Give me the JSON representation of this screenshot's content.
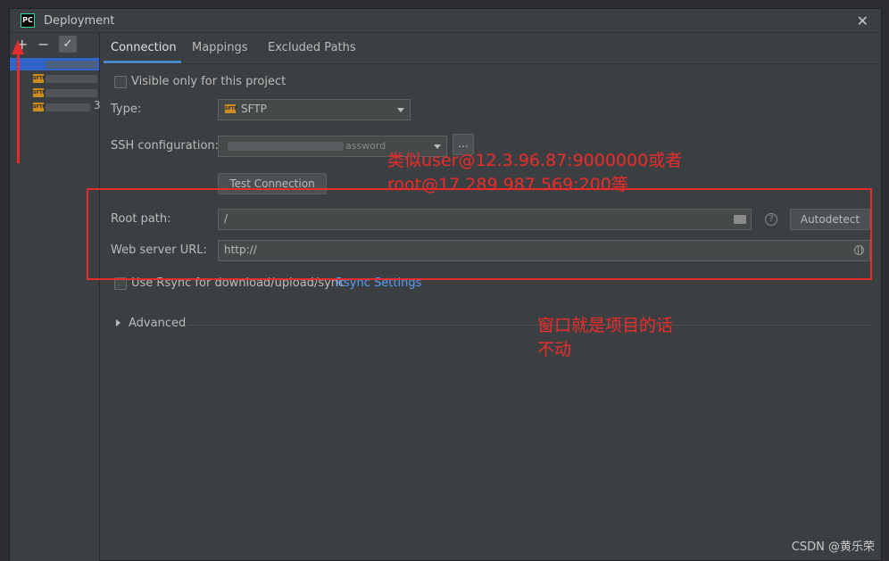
{
  "window": {
    "title": "Deployment",
    "app_icon": "PC",
    "close": "✕"
  },
  "sidebar": {
    "add": "+",
    "remove": "−",
    "check": "✓",
    "server_icon_text": "SFTP",
    "item_suffix": "3"
  },
  "tabs": [
    {
      "label": "Connection"
    },
    {
      "label": "Mappings"
    },
    {
      "label": "Excluded Paths"
    }
  ],
  "connection": {
    "visible_only_label": "Visible only for this project",
    "type_label": "Type:",
    "type_value": "SFTP",
    "type_icon_text": "SFTP",
    "ssh_label": "SSH configuration:",
    "ssh_suffix": "assword",
    "more_button": "...",
    "test_button": "Test Connection",
    "root_path_label": "Root path:",
    "root_path_value": "/",
    "help": "?",
    "autodetect_button": "Autodetect",
    "web_url_label": "Web server URL:",
    "web_url_value": "http://",
    "rsync_label": "Use Rsync for download/upload/sync",
    "rsync_link": "Rsync Settings",
    "advanced_label": "Advanced"
  },
  "annotations": {
    "line1": "类似user@12.3.96.87:9000000或者",
    "line2": "root@17.289.987.569:200等",
    "line3": "窗口就是项目的话",
    "line4": "不动"
  },
  "watermark": "CSDN @黄乐荣",
  "colors": {
    "accent": "#4a88c7",
    "annotation": "#e62d2d",
    "link": "#589df6",
    "selection": "#2f65ca"
  }
}
